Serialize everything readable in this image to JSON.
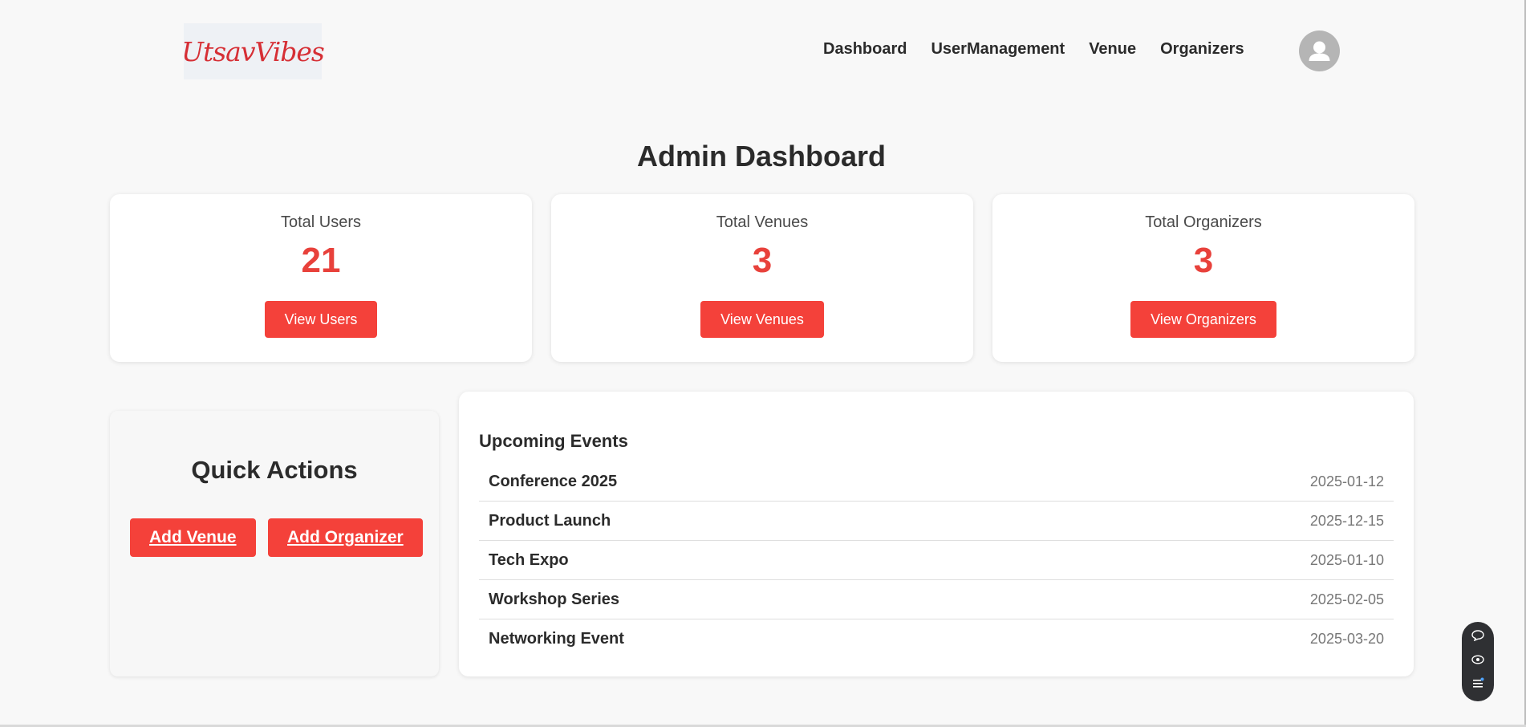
{
  "header": {
    "logo_text": "UtsavVibes",
    "nav": [
      "Dashboard",
      "UserManagement",
      "Venue",
      "Organizers"
    ]
  },
  "main": {
    "title": "Admin Dashboard",
    "cards": [
      {
        "label": "Total Users",
        "value": "21",
        "button": "View Users"
      },
      {
        "label": "Total Venues",
        "value": "3",
        "button": "View Venues"
      },
      {
        "label": "Total Organizers",
        "value": "3",
        "button": "View Organizers"
      }
    ],
    "quick_actions": {
      "title": "Quick Actions",
      "buttons": [
        "Add Venue",
        "Add Organizer"
      ]
    },
    "upcoming_events": {
      "title": "Upcoming Events",
      "items": [
        {
          "name": "Conference 2025",
          "date": "2025-01-12"
        },
        {
          "name": "Product Launch",
          "date": "2025-12-15"
        },
        {
          "name": "Tech Expo",
          "date": "2025-01-10"
        },
        {
          "name": "Workshop Series",
          "date": "2025-02-05"
        },
        {
          "name": "Networking Event",
          "date": "2025-03-20"
        }
      ]
    }
  },
  "colors": {
    "accent": "#f4413a",
    "value": "#e8413b",
    "background": "#f8f8f8"
  },
  "icons": {
    "avatar": "user-icon",
    "widget": [
      "chat-icon",
      "eye-icon",
      "menu-icon"
    ]
  }
}
